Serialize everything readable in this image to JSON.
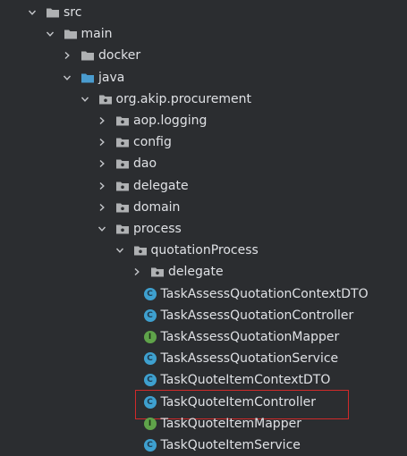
{
  "tree": [
    {
      "label": "src",
      "kind": "folder",
      "expanded": true,
      "depth": 0
    },
    {
      "label": "main",
      "kind": "folder",
      "expanded": true,
      "depth": 1
    },
    {
      "label": "docker",
      "kind": "folder",
      "expanded": false,
      "depth": 2
    },
    {
      "label": "java",
      "kind": "source-folder",
      "expanded": true,
      "depth": 2
    },
    {
      "label": "org.akip.procurement",
      "kind": "package",
      "expanded": true,
      "depth": 3
    },
    {
      "label": "aop.logging",
      "kind": "package",
      "expanded": false,
      "depth": 4
    },
    {
      "label": "config",
      "kind": "package",
      "expanded": false,
      "depth": 4
    },
    {
      "label": "dao",
      "kind": "package",
      "expanded": false,
      "depth": 4
    },
    {
      "label": "delegate",
      "kind": "package",
      "expanded": false,
      "depth": 4
    },
    {
      "label": "domain",
      "kind": "package",
      "expanded": false,
      "depth": 4
    },
    {
      "label": "process",
      "kind": "package",
      "expanded": true,
      "depth": 4
    },
    {
      "label": "quotationProcess",
      "kind": "package",
      "expanded": true,
      "depth": 5
    },
    {
      "label": "delegate",
      "kind": "package",
      "expanded": false,
      "depth": 6
    },
    {
      "label": "TaskAssessQuotationContextDTO",
      "kind": "class",
      "badge": "C",
      "depth": 7
    },
    {
      "label": "TaskAssessQuotationController",
      "kind": "class",
      "badge": "C",
      "depth": 7
    },
    {
      "label": "TaskAssessQuotationMapper",
      "kind": "interface",
      "badge": "I",
      "depth": 7
    },
    {
      "label": "TaskAssessQuotationService",
      "kind": "class",
      "badge": "C",
      "depth": 7
    },
    {
      "label": "TaskQuoteItemContextDTO",
      "kind": "class",
      "badge": "C",
      "depth": 7
    },
    {
      "label": "TaskQuoteItemController",
      "kind": "class",
      "badge": "C",
      "depth": 7,
      "highlighted": true
    },
    {
      "label": "TaskQuoteItemMapper",
      "kind": "interface",
      "badge": "I",
      "depth": 7
    },
    {
      "label": "TaskQuoteItemService",
      "kind": "class",
      "badge": "C",
      "depth": 7
    }
  ],
  "colors": {
    "background": "#2b2d30",
    "text": "#dfe1e5",
    "folder": "#afb1b3",
    "source_folder": "#4a9ccf",
    "class_badge": "#3ea0cf",
    "interface_badge": "#5fa34a",
    "highlight_border": "#d02a2a"
  }
}
